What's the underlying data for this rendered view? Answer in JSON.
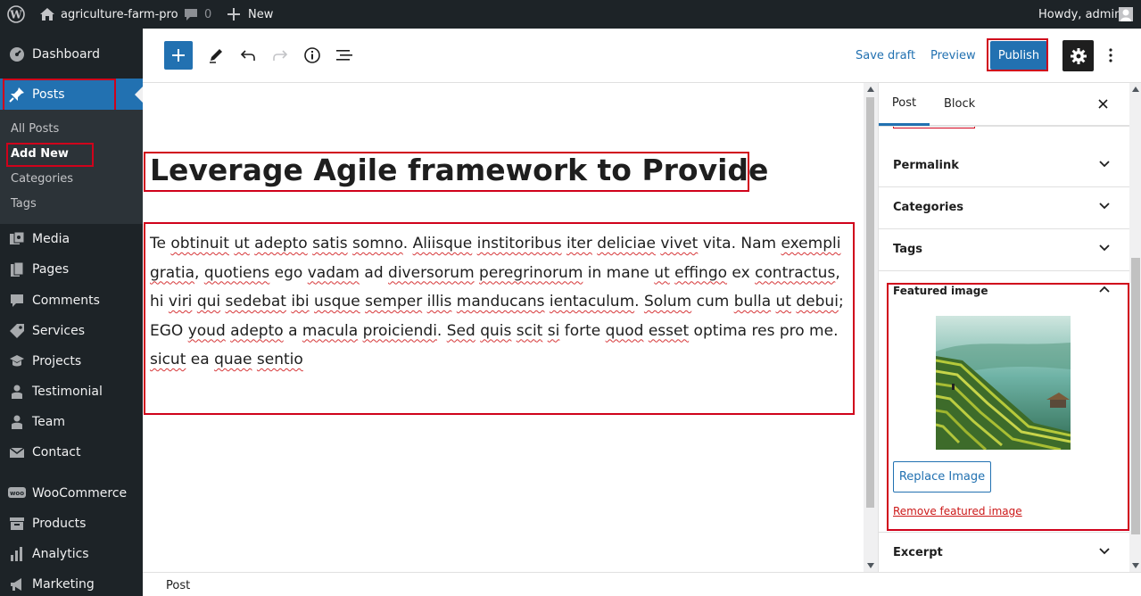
{
  "admin_bar": {
    "site_name": "agriculture-farm-pro",
    "comments_count": "0",
    "new_label": "New",
    "greeting": "Howdy, admin"
  },
  "sidebar": {
    "items": [
      {
        "label": "Dashboard",
        "icon": "dashboard-icon"
      },
      {
        "label": "Posts",
        "icon": "pin-icon",
        "active": true
      },
      {
        "label": "Media",
        "icon": "media-icon"
      },
      {
        "label": "Pages",
        "icon": "pages-icon"
      },
      {
        "label": "Comments",
        "icon": "comments-icon"
      },
      {
        "label": "Services",
        "icon": "tag-icon"
      },
      {
        "label": "Projects",
        "icon": "graduation-icon"
      },
      {
        "label": "Testimonial",
        "icon": "person-icon"
      },
      {
        "label": "Team",
        "icon": "person-icon"
      },
      {
        "label": "Contact",
        "icon": "mail-icon"
      },
      {
        "label": "WooCommerce",
        "icon": "woo-icon"
      },
      {
        "label": "Products",
        "icon": "archive-icon"
      },
      {
        "label": "Analytics",
        "icon": "bar-chart-icon"
      },
      {
        "label": "Marketing",
        "icon": "megaphone-icon"
      }
    ],
    "submenu": [
      "All Posts",
      "Add New",
      "Categories",
      "Tags"
    ]
  },
  "toolbar": {
    "save_draft": "Save draft",
    "preview": "Preview",
    "publish": "Publish"
  },
  "post": {
    "title": "Leverage Agile framework to Provide",
    "paragraph_words": [
      [
        "Te",
        false
      ],
      [
        " ",
        false
      ],
      [
        "obtinuit",
        true
      ],
      [
        " ",
        false
      ],
      [
        "ut",
        true
      ],
      [
        " ",
        false
      ],
      [
        "adepto",
        true
      ],
      [
        " ",
        false
      ],
      [
        "satis",
        true
      ],
      [
        " ",
        false
      ],
      [
        "somno",
        true
      ],
      [
        ". ",
        false
      ],
      [
        "Aliisque",
        true
      ],
      [
        " ",
        false
      ],
      [
        "institoribus",
        true
      ],
      [
        " ",
        false
      ],
      [
        "iter",
        true
      ],
      [
        " ",
        false
      ],
      [
        "deliciae",
        true
      ],
      [
        " ",
        false
      ],
      [
        "vivet",
        true
      ],
      [
        " vita. Nam ",
        false
      ],
      [
        "exempli",
        true
      ],
      [
        " ",
        false
      ],
      [
        "gratia",
        true
      ],
      [
        ", ",
        false
      ],
      [
        "quotiens",
        true
      ],
      [
        " ego ",
        false
      ],
      [
        "vadam",
        true
      ],
      [
        " ad ",
        false
      ],
      [
        "diversorum",
        true
      ],
      [
        " ",
        false
      ],
      [
        "peregrinorum",
        true
      ],
      [
        " in mane ",
        false
      ],
      [
        "ut",
        true
      ],
      [
        " ",
        false
      ],
      [
        "effingo",
        true
      ],
      [
        " ex ",
        false
      ],
      [
        "contractus",
        true
      ],
      [
        ", hi ",
        false
      ],
      [
        "viri",
        true
      ],
      [
        " ",
        false
      ],
      [
        "qui",
        true
      ],
      [
        " ",
        false
      ],
      [
        "sedebat",
        true
      ],
      [
        " ",
        false
      ],
      [
        "ibi",
        true
      ],
      [
        " ",
        false
      ],
      [
        "usque",
        true
      ],
      [
        " ",
        false
      ],
      [
        "semper",
        true
      ],
      [
        " ",
        false
      ],
      [
        "illis",
        true
      ],
      [
        " ",
        false
      ],
      [
        "manducans",
        true
      ],
      [
        " ",
        false
      ],
      [
        "ientaculum",
        true
      ],
      [
        ". ",
        false
      ],
      [
        "Solum",
        true
      ],
      [
        " cum ",
        false
      ],
      [
        "bulla",
        true
      ],
      [
        " ",
        false
      ],
      [
        "ut",
        true
      ],
      [
        " ",
        false
      ],
      [
        "debui",
        true
      ],
      [
        "; EGO ",
        false
      ],
      [
        "youd",
        true
      ],
      [
        " ",
        false
      ],
      [
        "adepto",
        true
      ],
      [
        " a ",
        false
      ],
      [
        "macula",
        true
      ],
      [
        " ",
        false
      ],
      [
        "proiciendi",
        true
      ],
      [
        ". ",
        false
      ],
      [
        "Sed",
        true
      ],
      [
        " ",
        false
      ],
      [
        "quis",
        true
      ],
      [
        " ",
        false
      ],
      [
        "scit",
        true
      ],
      [
        " ",
        false
      ],
      [
        "si",
        true
      ],
      [
        " forte ",
        false
      ],
      [
        "quod",
        true
      ],
      [
        " ",
        false
      ],
      [
        "esset",
        true
      ],
      [
        " optima res pro me. ",
        false
      ],
      [
        "sicut",
        true
      ],
      [
        " ea ",
        false
      ],
      [
        "quae",
        true
      ],
      [
        " ",
        false
      ],
      [
        "sentio",
        true
      ]
    ]
  },
  "settings": {
    "tabs": [
      "Post",
      "Block"
    ],
    "panels": [
      "Permalink",
      "Categories",
      "Tags"
    ],
    "featured_image": {
      "title": "Featured image",
      "replace_label": "Replace Image",
      "remove_label": "Remove featured image"
    },
    "excerpt": "Excerpt"
  },
  "footer": {
    "breadcrumb": "Post"
  },
  "colors": {
    "admin_dark": "#1d2327",
    "accent": "#2271b1",
    "highlight": "#d0021b"
  }
}
